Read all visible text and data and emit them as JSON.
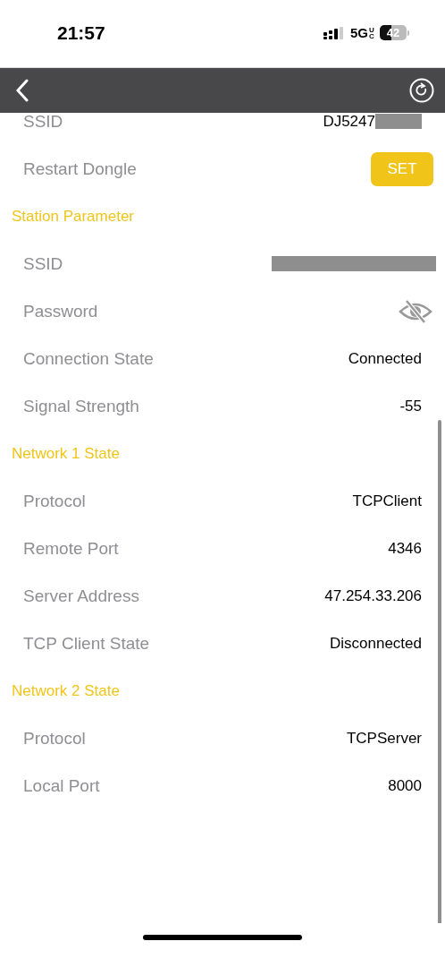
{
  "status_bar": {
    "time": "21:57",
    "network": "5G",
    "network_sub": "UC",
    "battery": "42"
  },
  "sections": [
    {
      "rows": [
        {
          "kind": "text",
          "label": "SSID",
          "value": "DJ5247",
          "redacted": true
        },
        {
          "kind": "button",
          "label": "Restart Dongle",
          "button": "SET"
        }
      ]
    },
    {
      "title": "Station Parameter",
      "rows": [
        {
          "kind": "text",
          "label": "SSID",
          "redacted": true
        },
        {
          "kind": "password",
          "label": "Password"
        },
        {
          "kind": "text",
          "label": "Connection State",
          "value": "Connected"
        },
        {
          "kind": "text",
          "label": "Signal Strength",
          "value": "-55"
        }
      ]
    },
    {
      "title": "Network 1 State",
      "rows": [
        {
          "kind": "text",
          "label": "Protocol",
          "value": "TCPClient"
        },
        {
          "kind": "text",
          "label": "Remote Port",
          "value": "4346"
        },
        {
          "kind": "text",
          "label": "Server Address",
          "value": "47.254.33.206"
        },
        {
          "kind": "text",
          "label": "TCP Client State",
          "value": "Disconnected"
        }
      ]
    },
    {
      "title": "Network 2 State",
      "rows": [
        {
          "kind": "text",
          "label": "Protocol",
          "value": "TCPServer"
        },
        {
          "kind": "text",
          "label": "Local Port",
          "value": "8000"
        }
      ]
    }
  ]
}
